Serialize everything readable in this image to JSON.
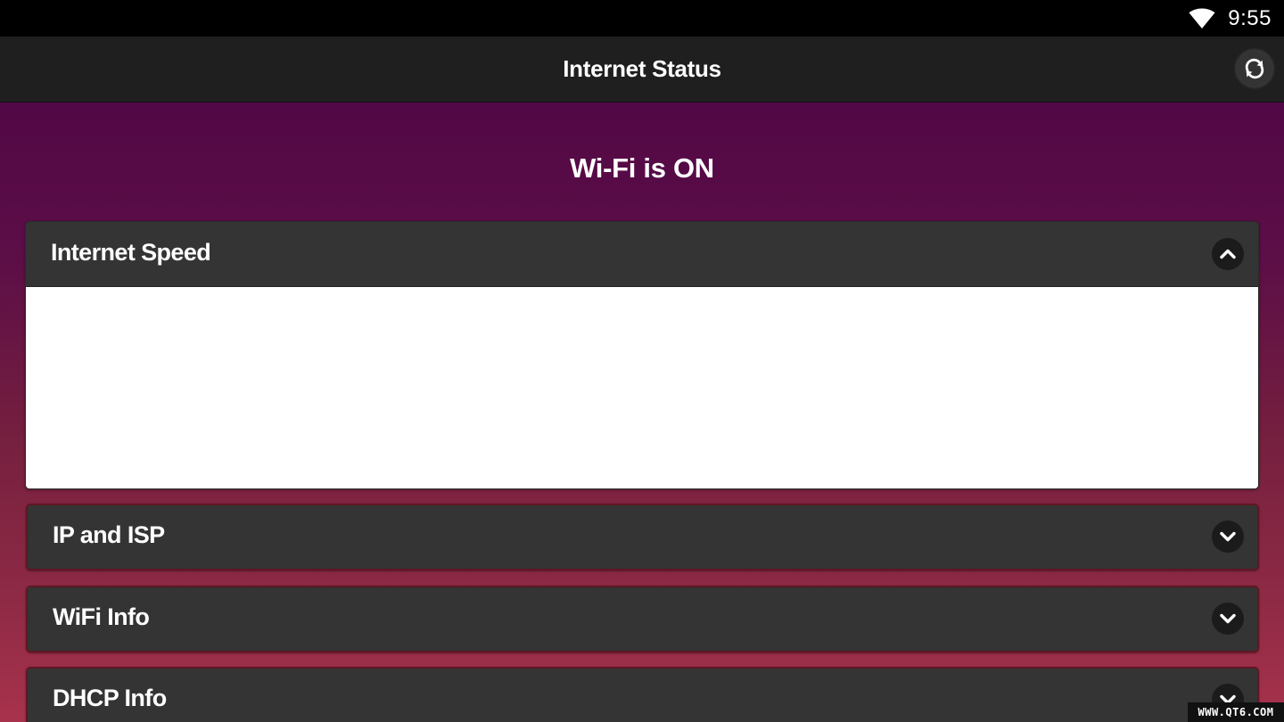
{
  "status_bar": {
    "time": "9:55",
    "wifi_icon": "wifi-signal-icon"
  },
  "app_bar": {
    "title": "Internet Status",
    "refresh_icon": "refresh-icon"
  },
  "main": {
    "wifi_status": "Wi-Fi is ON",
    "panels": [
      {
        "title": "Internet Speed",
        "expanded": true,
        "icon": "chevron-up-icon"
      },
      {
        "title": "IP and ISP",
        "expanded": false,
        "icon": "chevron-down-icon"
      },
      {
        "title": "WiFi Info",
        "expanded": false,
        "icon": "chevron-down-icon"
      },
      {
        "title": "DHCP Info",
        "expanded": false,
        "icon": "chevron-down-icon"
      }
    ]
  },
  "watermark": "WWW.QT6.COM",
  "colors": {
    "status_bar": "#000000",
    "app_bar": "#1f1f1f",
    "gradient_top": "#520846",
    "gradient_bottom": "#a8324c",
    "panel_header": "#343434",
    "panel_body": "#ffffff"
  }
}
